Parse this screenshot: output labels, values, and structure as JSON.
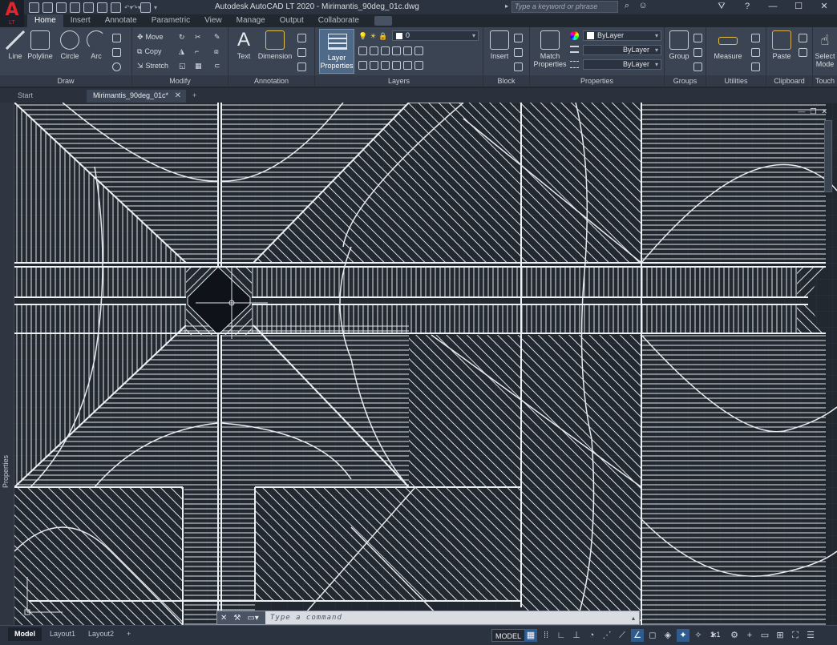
{
  "app": {
    "logo_text": "A",
    "logo_sub": "LT",
    "window_title": "Autodesk AutoCAD LT 2020 -  Mirimantis_90deg_01c.dwg",
    "search_placeholder": "Type a keyword or phrase"
  },
  "window_controls": {
    "minimize": "—",
    "maximize": "☐",
    "close": "✕"
  },
  "ribbon_tabs": [
    "Home",
    "Insert",
    "Annotate",
    "Parametric",
    "View",
    "Manage",
    "Output",
    "Collaborate"
  ],
  "panels": {
    "draw": {
      "title": "Draw",
      "line": "Line",
      "polyline": "Polyline",
      "circle": "Circle",
      "arc": "Arc"
    },
    "modify": {
      "title": "Modify",
      "move": "Move",
      "copy": "Copy",
      "stretch": "Stretch"
    },
    "annotation": {
      "title": "Annotation",
      "text": "Text",
      "dimension": "Dimension"
    },
    "layers": {
      "title": "Layers",
      "layer_properties_1": "Layer",
      "layer_properties_2": "Properties",
      "current_layer": "0"
    },
    "block": {
      "title": "Block",
      "insert": "Insert"
    },
    "properties": {
      "title": "Properties",
      "match_1": "Match",
      "match_2": "Properties",
      "color": "ByLayer",
      "linetype": "ByLayer",
      "lineweight": "ByLayer"
    },
    "groups": {
      "title": "Groups",
      "group": "Group"
    },
    "utilities": {
      "title": "Utilities",
      "measure": "Measure"
    },
    "clipboard": {
      "title": "Clipboard",
      "paste": "Paste"
    },
    "touch": {
      "title": "Touch",
      "select_1": "Select",
      "select_2": "Mode"
    }
  },
  "file_tabs": [
    {
      "label": "Start"
    },
    {
      "label": "Mirimantis_90deg_01c*",
      "close": "✕"
    }
  ],
  "file_tab_add": "+",
  "side_panel_label": "Properties",
  "viewport_controls": {
    "minimize": "—",
    "restore": "❐",
    "close": "✕"
  },
  "command_line": {
    "placeholder": "Type a command",
    "close_icon": "✕",
    "customize_icon": "🔧"
  },
  "layout_tabs": [
    "Model",
    "Layout1",
    "Layout2"
  ],
  "layout_add": "+",
  "status": {
    "model": "MODEL",
    "scale": "1:1"
  }
}
